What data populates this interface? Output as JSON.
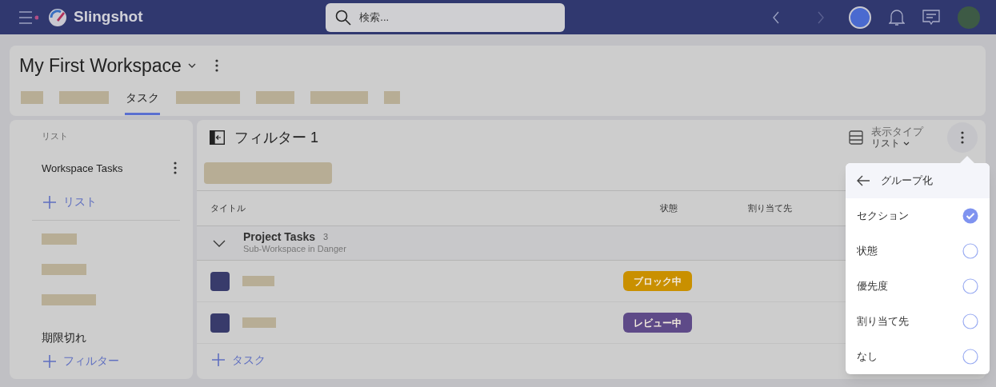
{
  "app": {
    "name": "Slingshot",
    "search_placeholder": "検索..."
  },
  "workspace": {
    "title": "My First Workspace",
    "tabs": [
      {
        "kind": "redacted",
        "selected": false
      },
      {
        "kind": "redacted",
        "selected": false
      },
      {
        "kind": "text",
        "label": "タスク",
        "selected": true
      },
      {
        "kind": "redacted",
        "selected": false
      },
      {
        "kind": "redacted",
        "selected": false
      },
      {
        "kind": "redacted",
        "selected": false
      },
      {
        "kind": "redacted",
        "selected": false
      }
    ]
  },
  "sidebar": {
    "heading": "リスト",
    "list": "Workspace Tasks",
    "add_list": "リスト",
    "filters": [
      {
        "kind": "redacted"
      },
      {
        "kind": "redacted"
      },
      {
        "kind": "redacted"
      },
      {
        "kind": "text",
        "label": "期限切れ"
      }
    ],
    "add_filter": "フィルター"
  },
  "main": {
    "title": "フィルター 1",
    "view_type_label": "表示タイプ",
    "view_type_value": "リスト",
    "columns": [
      "タイトル",
      "状態",
      "割り当て先"
    ],
    "section": {
      "title": "Project Tasks",
      "count": "3",
      "subtitle": "Sub-Workspace in Danger",
      "expanded": true
    },
    "rows": [
      {
        "status": "ブロック中",
        "color": "#c99000"
      },
      {
        "status": "レビュー中",
        "color": "#5e4a88"
      }
    ],
    "add_task": "タスク"
  },
  "menu": {
    "title": "グループ化",
    "options": [
      {
        "label": "セクション",
        "selected": true
      },
      {
        "label": "状態",
        "selected": false
      },
      {
        "label": "優先度",
        "selected": false
      },
      {
        "label": "割り当て先",
        "selected": false
      },
      {
        "label": "なし",
        "selected": false
      }
    ]
  }
}
